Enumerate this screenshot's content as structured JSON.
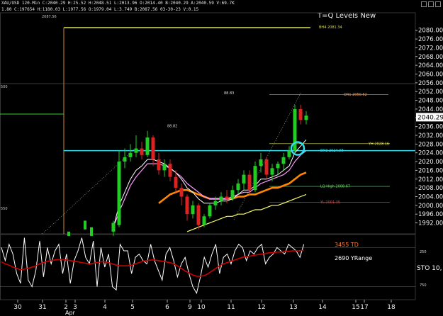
{
  "header": {
    "symbol_line": "XAU/USD 120-Min  C:2040.29  H:25.52  H:2048.51  L:2013.96  O:2014.40  B:2040.29  A:2040.59  V:69.7K",
    "ohlc_line": "1.80  C:197654  H:1180.03  L:1977.56  O:1979.04  L:3.749  B:2087.56  03-30-23  V:0.15"
  },
  "title": "T=Q Levels New",
  "window_icons": [
    "minimize-icon",
    "restore-icon",
    "close-icon"
  ],
  "colors": {
    "bg": "#000000",
    "up": "#22cc22",
    "down": "#dd2222",
    "ema_fast": "#ffffff",
    "ema_pink": "#ff99ff",
    "ema_orange": "#ff8800",
    "ema_yellow": "#ffff66",
    "cyan_level": "#33ddee",
    "stoch_white": "#ffffff",
    "stoch_red": "#cc0000",
    "accent_orange": "#ff7733"
  },
  "chart_data": [
    {
      "type": "candlestick",
      "title": "T=Q Levels New",
      "price_axis": {
        "ylim": [
          1987,
          2088
        ],
        "ticks": [
          2080,
          2076,
          2072,
          2068,
          2064,
          2060,
          2056,
          2052,
          2048,
          2044,
          2040,
          2036,
          2032,
          2028,
          2024,
          2020,
          2016,
          2012,
          2008,
          2004,
          2000,
          1996,
          1992
        ],
        "current_price": "2040.29",
        "left_labels": [
          "2087.56",
          "500",
          "550"
        ]
      },
      "x_axis": {
        "labels": [
          "30",
          "31",
          "2",
          "3",
          "4",
          "5",
          "6",
          "9",
          "10",
          "11",
          "12",
          "13",
          "14",
          "15",
          "17",
          "18"
        ],
        "month_label": "Apr"
      },
      "levels": [
        {
          "label": "BH4 2081.34",
          "value": 2081.34,
          "color": "#dddd55"
        },
        {
          "label": "DR1 2050.62",
          "value": 2050.62,
          "color": "#ff9944"
        },
        {
          "label": "YH 2028.16",
          "value": 2028.16,
          "color": "#dddd55"
        },
        {
          "label": "BH3 2024.98",
          "value": 2024.98,
          "color": "#33ddee"
        },
        {
          "label": "LQ High 2008.67",
          "value": 2008.67,
          "color": "#66dd66"
        },
        {
          "label": "YL 2001.35",
          "value": 2001.35,
          "color": "#dd4444"
        }
      ],
      "annotations": [
        {
          "label": "88.82",
          "x": 7,
          "value": 2034.5
        },
        {
          "label": "88.83",
          "x": 17,
          "value": 2049.5
        }
      ],
      "candles": [
        {
          "o": 1988,
          "h": 1993,
          "l": 1986,
          "c": 1992
        },
        {
          "o": 1991,
          "h": 2025,
          "l": 1990,
          "c": 2020
        },
        {
          "o": 2020,
          "h": 2026,
          "l": 2017,
          "c": 2022
        },
        {
          "o": 2022,
          "h": 2028,
          "l": 2020,
          "c": 2024
        },
        {
          "o": 2024,
          "h": 2032,
          "l": 2022,
          "c": 2026
        },
        {
          "o": 2026,
          "h": 2029,
          "l": 2021,
          "c": 2023
        },
        {
          "o": 2023,
          "h": 2034,
          "l": 2022,
          "c": 2031
        },
        {
          "o": 2031,
          "h": 2032,
          "l": 2018,
          "c": 2021
        },
        {
          "o": 2021,
          "h": 2024,
          "l": 2014,
          "c": 2016
        },
        {
          "o": 2016,
          "h": 2021,
          "l": 2013,
          "c": 2019
        },
        {
          "o": 2019,
          "h": 2021,
          "l": 2011,
          "c": 2013
        },
        {
          "o": 2013,
          "h": 2016,
          "l": 2006,
          "c": 2008
        },
        {
          "o": 2008,
          "h": 2010,
          "l": 2000,
          "c": 2004
        },
        {
          "o": 2004,
          "h": 2005,
          "l": 1993,
          "c": 1996
        },
        {
          "o": 1996,
          "h": 2002,
          "l": 1994,
          "c": 2000
        },
        {
          "o": 2000,
          "h": 2001,
          "l": 1989,
          "c": 1991
        },
        {
          "o": 1991,
          "h": 1996,
          "l": 1990,
          "c": 1995
        },
        {
          "o": 1995,
          "h": 2001,
          "l": 1994,
          "c": 2000
        },
        {
          "o": 2000,
          "h": 2004,
          "l": 1998,
          "c": 2002
        },
        {
          "o": 2002,
          "h": 2006,
          "l": 2000,
          "c": 2004
        },
        {
          "o": 2004,
          "h": 2007,
          "l": 2001,
          "c": 2003
        },
        {
          "o": 2003,
          "h": 2009,
          "l": 2002,
          "c": 2007
        },
        {
          "o": 2007,
          "h": 2012,
          "l": 2005,
          "c": 2010
        },
        {
          "o": 2010,
          "h": 2016,
          "l": 2007,
          "c": 2014
        },
        {
          "o": 2014,
          "h": 2016,
          "l": 2005,
          "c": 2007
        },
        {
          "o": 2007,
          "h": 2020,
          "l": 2006,
          "c": 2018
        },
        {
          "o": 2018,
          "h": 2024,
          "l": 2015,
          "c": 2021
        },
        {
          "o": 2021,
          "h": 2022,
          "l": 2012,
          "c": 2014
        },
        {
          "o": 2014,
          "h": 2019,
          "l": 2011,
          "c": 2017
        },
        {
          "o": 2017,
          "h": 2020,
          "l": 2014,
          "c": 2019
        },
        {
          "o": 2019,
          "h": 2024,
          "l": 2016,
          "c": 2022
        },
        {
          "o": 2022,
          "h": 2027,
          "l": 2021,
          "c": 2025
        },
        {
          "o": 2025,
          "h": 2046,
          "l": 2024,
          "c": 2044
        },
        {
          "o": 2044,
          "h": 2046,
          "l": 2037,
          "c": 2039
        },
        {
          "o": 2039,
          "h": 2043,
          "l": 2037,
          "c": 2041
        }
      ],
      "ema_fast": [
        1990,
        2000,
        2006,
        2012,
        2016,
        2018,
        2021,
        2021,
        2020,
        2019,
        2017,
        2015,
        2012,
        2008,
        2006,
        2003,
        2001,
        2001,
        2001,
        2002,
        2002,
        2003,
        2005,
        2007,
        2007,
        2009,
        2012,
        2012,
        2013,
        2014,
        2016,
        2018,
        2024,
        2027,
        2030
      ],
      "ema_pink": [
        1990,
        1997,
        2003,
        2009,
        2013,
        2016,
        2019,
        2019,
        2019,
        2018,
        2017,
        2015,
        2013,
        2010,
        2008,
        2006,
        2004,
        2003,
        2003,
        2003,
        2003,
        2004,
        2005,
        2006,
        2006,
        2008,
        2010,
        2011,
        2012,
        2013,
        2014,
        2016,
        2020,
        2023,
        2025
      ],
      "ema_orange": [
        null,
        null,
        null,
        null,
        null,
        null,
        null,
        null,
        2001,
        2003,
        2005,
        2006,
        2007,
        2007,
        2006,
        2005,
        2004,
        2003,
        2003,
        2003,
        2003,
        2003,
        2004,
        2004,
        2005,
        2005,
        2006,
        2007,
        2008,
        2008,
        2009,
        2010,
        2012,
        2014,
        2015
      ],
      "ema_yellow": [
        null,
        null,
        null,
        null,
        null,
        null,
        null,
        null,
        null,
        null,
        null,
        null,
        null,
        1988,
        1989,
        1990,
        1991,
        1992,
        1993,
        1994,
        1995,
        1995,
        1996,
        1996,
        1997,
        1998,
        1998,
        1999,
        2000,
        2000,
        2001,
        2002,
        2003,
        2004,
        2005
      ]
    },
    {
      "type": "line",
      "title": "",
      "labels": [
        "3455 TD",
        "2690 YRange"
      ],
      "right_label": "STO",
      "right_value": "10,",
      "ticks": [
        "250",
        "750"
      ],
      "ylim": [
        0,
        100
      ],
      "levels": [
        80,
        20
      ],
      "series": [
        {
          "name": "",
          "values": [
            80,
            60,
            85,
            70,
            40,
            25,
            95,
            30,
            20,
            45,
            90,
            35,
            80,
            55,
            75,
            85,
            40,
            70,
            25,
            60,
            75,
            95,
            65,
            55,
            90,
            20,
            80,
            50,
            70,
            20,
            15,
            85,
            75,
            75,
            40,
            65,
            70,
            60,
            55,
            85,
            60,
            45,
            30,
            70,
            80,
            60,
            35,
            55,
            65,
            40,
            20,
            10,
            35,
            65,
            50,
            70,
            85,
            40,
            65,
            70,
            55,
            75,
            85,
            80,
            60,
            75,
            70,
            80,
            85,
            55,
            65,
            70,
            80,
            75,
            70,
            85,
            80,
            75,
            65,
            85
          ]
        },
        {
          "name": "",
          "values": [
            58,
            55,
            53,
            50,
            48,
            46,
            47,
            48,
            50,
            52,
            55,
            57,
            59,
            60,
            61,
            62,
            62,
            61,
            60,
            59,
            58,
            57,
            56,
            55,
            56,
            57,
            58,
            58,
            57,
            55,
            53,
            52,
            52,
            52,
            53,
            55,
            57,
            59,
            60,
            61,
            61,
            60,
            59,
            58,
            57,
            55,
            52,
            48,
            44,
            41,
            38,
            36,
            36,
            37,
            40,
            44,
            48,
            52,
            55,
            57,
            59,
            61,
            63,
            65,
            66,
            67,
            68,
            69,
            70,
            71,
            72,
            72,
            73,
            73,
            74,
            74,
            75,
            75,
            75,
            76
          ]
        }
      ]
    }
  ]
}
